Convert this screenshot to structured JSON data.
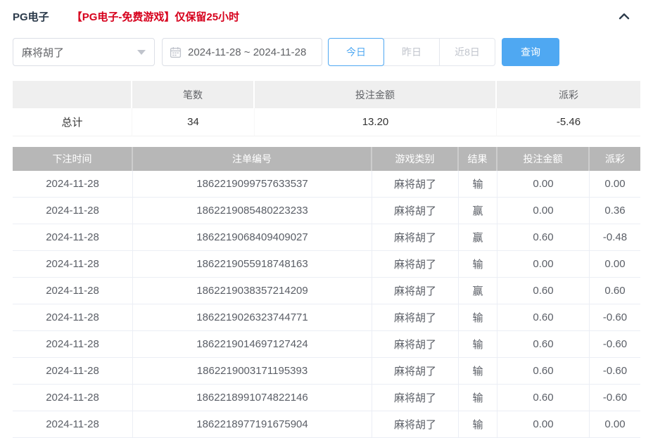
{
  "header": {
    "title": "PG电子",
    "notice": "【PG电子-免费游戏】仅保留25小时"
  },
  "filters": {
    "game_select": {
      "value": "麻将胡了"
    },
    "date_range": {
      "value": "2024-11-28 ~ 2024-11-28"
    },
    "quick_buttons": [
      {
        "label": "今日",
        "active": true
      },
      {
        "label": "昨日",
        "active": false
      },
      {
        "label": "近8日",
        "active": false
      }
    ],
    "search_button": "查询"
  },
  "summary": {
    "headers": [
      "",
      "笔数",
      "投注金额",
      "派彩"
    ],
    "row_label": "总计",
    "count": "34",
    "bet_amount": "13.20",
    "payout": "-5.46"
  },
  "table": {
    "headers": [
      "下注时间",
      "注单编号",
      "游戏类别",
      "结果",
      "投注金额",
      "派彩"
    ],
    "rows": [
      {
        "date": "2024-11-28",
        "order_id": "1862219099757633537",
        "game": "麻将胡了",
        "result": "输",
        "bet": "0.00",
        "payout": "0.00"
      },
      {
        "date": "2024-11-28",
        "order_id": "1862219085480223233",
        "game": "麻将胡了",
        "result": "赢",
        "bet": "0.00",
        "payout": "0.36"
      },
      {
        "date": "2024-11-28",
        "order_id": "1862219068409409027",
        "game": "麻将胡了",
        "result": "赢",
        "bet": "0.60",
        "payout": "-0.48"
      },
      {
        "date": "2024-11-28",
        "order_id": "1862219055918748163",
        "game": "麻将胡了",
        "result": "输",
        "bet": "0.00",
        "payout": "0.00"
      },
      {
        "date": "2024-11-28",
        "order_id": "1862219038357214209",
        "game": "麻将胡了",
        "result": "赢",
        "bet": "0.60",
        "payout": "0.60"
      },
      {
        "date": "2024-11-28",
        "order_id": "1862219026323744771",
        "game": "麻将胡了",
        "result": "输",
        "bet": "0.60",
        "payout": "-0.60"
      },
      {
        "date": "2024-11-28",
        "order_id": "1862219014697127424",
        "game": "麻将胡了",
        "result": "输",
        "bet": "0.60",
        "payout": "-0.60"
      },
      {
        "date": "2024-11-28",
        "order_id": "1862219003171195393",
        "game": "麻将胡了",
        "result": "输",
        "bet": "0.60",
        "payout": "-0.60"
      },
      {
        "date": "2024-11-28",
        "order_id": "1862218991074822146",
        "game": "麻将胡了",
        "result": "输",
        "bet": "0.60",
        "payout": "-0.60"
      },
      {
        "date": "2024-11-28",
        "order_id": "1862218977191675904",
        "game": "麻将胡了",
        "result": "输",
        "bet": "0.00",
        "payout": "0.00"
      }
    ]
  },
  "colors": {
    "accent_blue": "#4fa8f2",
    "danger_red": "#f56c6c",
    "notice_red": "#d6001c",
    "title_navy": "#2b3a4a",
    "table_header_gray": "#b7b7b7"
  }
}
